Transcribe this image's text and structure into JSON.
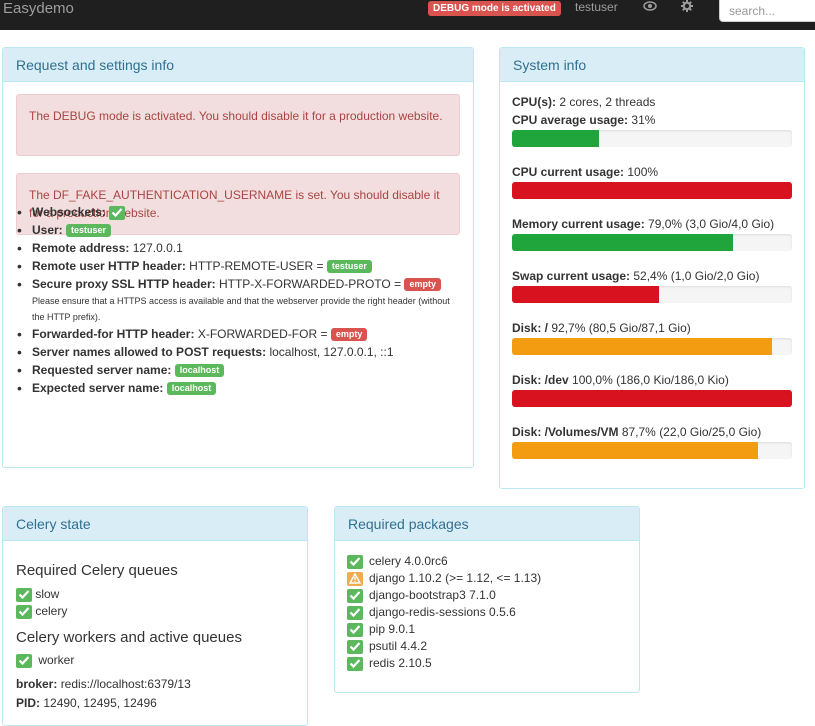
{
  "navbar": {
    "brand": "Easydemo",
    "debug_badge": "DEBUG mode is activated",
    "user": "testuser",
    "search_placeholder": "search..."
  },
  "request_panel": {
    "title": "Request and settings info",
    "alerts": [
      "The DEBUG mode is activated. You should disable it for a production website.",
      "The DF_FAKE_AUTHENTICATION_USERNAME is set. You should disable it for a production website."
    ],
    "items": {
      "websockets_label": "Websockets:",
      "user_label": "User:",
      "user_value": "testuser",
      "remote_address_label": "Remote address:",
      "remote_address_value": "127.0.0.1",
      "remote_user_label": "Remote user HTTP header:",
      "remote_user_value": "HTTP-REMOTE-USER =",
      "remote_user_badge": "testuser",
      "secure_proxy_label": "Secure proxy SSL HTTP header:",
      "secure_proxy_value": "HTTP-X-FORWARDED-PROTO =",
      "secure_proxy_badge": "empty",
      "secure_proxy_note": "Please ensure that a HTTPS access is available and that the webserver provide the right header (without the HTTP prefix).",
      "forwarded_label": "Forwarded-for HTTP header:",
      "forwarded_value": "X-FORWARDED-FOR =",
      "forwarded_badge": "empty",
      "server_names_label": "Server names allowed to POST requests:",
      "server_names_value": "localhost, 127.0.0.1, ::1",
      "requested_label": "Requested server name:",
      "requested_badge": "localhost",
      "expected_label": "Expected server name:",
      "expected_badge": "localhost"
    }
  },
  "system_panel": {
    "title": "System info",
    "cpus_label": "CPU(s):",
    "cpus_value": "2 cores, 2 threads",
    "metrics": [
      {
        "label": "CPU average usage:",
        "value": "31%",
        "percent": 31,
        "color": "#1fa53c"
      },
      {
        "label": "CPU current usage:",
        "value": "100%",
        "percent": 100,
        "color": "#d8121e"
      },
      {
        "label": "Memory current usage:",
        "value": "79,0% (3,0 Gio/4,0 Gio)",
        "percent": 79,
        "color": "#1fa53c"
      },
      {
        "label": "Swap current usage:",
        "value": "52,4% (1,0 Gio/2,0 Gio)",
        "percent": 52.4,
        "color": "#d8121e"
      },
      {
        "label": "Disk: /",
        "value": "92,7% (80,5 Gio/87,1 Gio)",
        "percent": 92.7,
        "color": "#f39c12"
      },
      {
        "label": "Disk: /dev",
        "value": "100,0% (186,0 Kio/186,0 Kio)",
        "percent": 100,
        "color": "#d8121e"
      },
      {
        "label": "Disk: /Volumes/VM",
        "value": "87,7% (22,0 Gio/25,0 Gio)",
        "percent": 87.7,
        "color": "#f39c12"
      }
    ]
  },
  "celery_panel": {
    "title": "Celery state",
    "queues_heading": "Required Celery queues",
    "queues": [
      "slow",
      "celery"
    ],
    "workers_heading": "Celery workers and active queues",
    "workers": [
      "worker"
    ],
    "broker_label": "broker:",
    "broker_value": "redis://localhost:6379/13",
    "pid_label": "PID:",
    "pid_value": "12490, 12495, 12496"
  },
  "packages_panel": {
    "title": "Required packages",
    "packages": [
      {
        "name": "celery 4.0.0rc6",
        "status": "ok"
      },
      {
        "name": "django 1.10.2 (>= 1.12, <= 1.13)",
        "status": "warning"
      },
      {
        "name": "django-bootstrap3 7.1.0",
        "status": "ok"
      },
      {
        "name": "django-redis-sessions 0.5.6",
        "status": "ok"
      },
      {
        "name": "pip 9.0.1",
        "status": "ok"
      },
      {
        "name": "psutil 4.4.2",
        "status": "ok"
      },
      {
        "name": "redis 2.10.5",
        "status": "ok"
      }
    ]
  }
}
